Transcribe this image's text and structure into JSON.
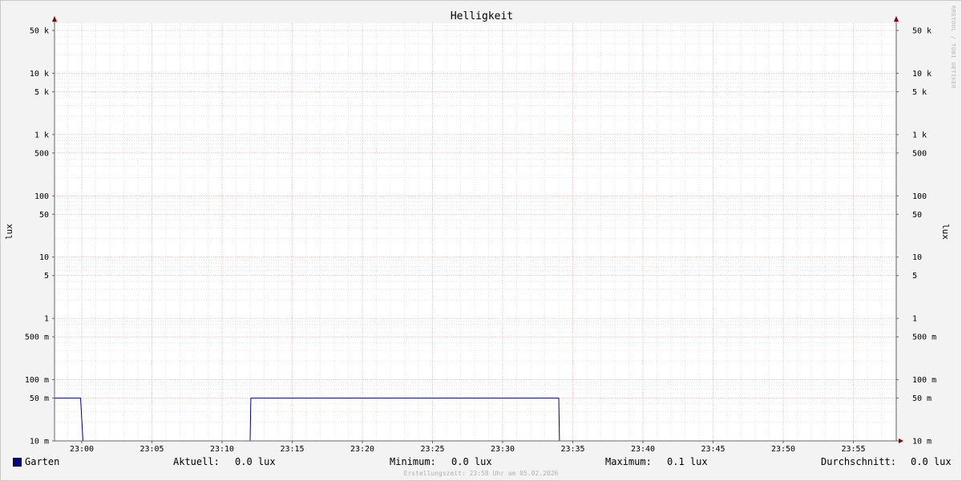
{
  "chart_data": {
    "type": "line",
    "title": "Helligkeit",
    "ylabel": "lux",
    "y_scale": "log",
    "ylim": [
      0.01,
      80000
    ],
    "x_ticks": [
      "23:00",
      "23:05",
      "23:10",
      "23:15",
      "23:20",
      "23:25",
      "23:30",
      "23:35",
      "23:40",
      "23:45",
      "23:50",
      "23:55"
    ],
    "y_ticks": [
      {
        "value": 50000,
        "label": "50 k"
      },
      {
        "value": 10000,
        "label": "10 k"
      },
      {
        "value": 5000,
        "label": "5 k"
      },
      {
        "value": 1000,
        "label": "1 k"
      },
      {
        "value": 500,
        "label": "500"
      },
      {
        "value": 100,
        "label": "100"
      },
      {
        "value": 50,
        "label": "50"
      },
      {
        "value": 10,
        "label": "10"
      },
      {
        "value": 5,
        "label": "5"
      },
      {
        "value": 1,
        "label": "1"
      },
      {
        "value": 0.5,
        "label": "500 m"
      },
      {
        "value": 0.1,
        "label": "100 m"
      },
      {
        "value": 0.05,
        "label": "50 m"
      },
      {
        "value": 0.01,
        "label": "10 m"
      }
    ],
    "series": [
      {
        "name": "Garten",
        "color": "#00008b",
        "points": [
          {
            "x": "22:58",
            "y": 0.05
          },
          {
            "x": "22:59:55",
            "y": 0.05
          },
          {
            "x": "23:00:05",
            "y": 0.01
          },
          {
            "x": "23:12",
            "y": 0.01
          },
          {
            "x": "23:12:03",
            "y": 0.05
          },
          {
            "x": "23:34",
            "y": 0.05
          },
          {
            "x": "23:34:03",
            "y": 0.01
          },
          {
            "x": "23:58",
            "y": 0.01
          }
        ]
      }
    ],
    "grid": true
  },
  "legend": {
    "series_name": "Garten",
    "current_label": "Aktuell:",
    "current_value": "0.0 lux",
    "min_label": "Minimum:",
    "min_value": "0.0 lux",
    "max_label": "Maximum:",
    "max_value": "0.1 lux",
    "avg_label": "Durchschnitt:",
    "avg_value": "0.0 lux"
  },
  "watermark": "RRDTOOL / TOBI OETIKER",
  "footer": "Erstellungszeit: 23:58 Uhr am 05.02.2026",
  "colors": {
    "series": "#00008b",
    "major_grid": "#e8a0a0",
    "minor_grid": "#c8c8c8",
    "axis_arrow": "#8b0000"
  }
}
